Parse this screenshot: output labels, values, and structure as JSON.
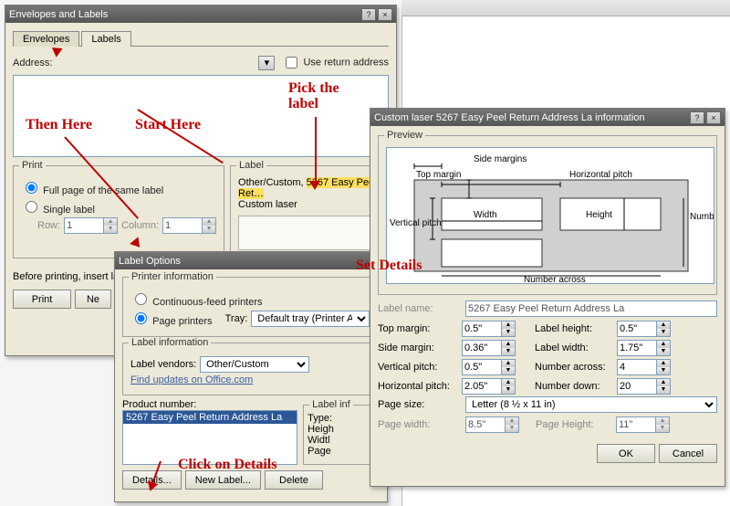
{
  "envelopesDialog": {
    "title": "Envelopes and Labels",
    "tabs": {
      "envelopes": "Envelopes",
      "labels": "Labels"
    },
    "addressLabel": "Address:",
    "useReturn": "Use return address",
    "printGroup": {
      "legend": "Print",
      "fullPage": "Full page of the same label",
      "single": "Single label",
      "rowLabel": "Row:",
      "rowValue": "1",
      "colLabel": "Column:",
      "colValue": "1"
    },
    "labelGroup": {
      "legend": "Label",
      "line1a": "Other/Custom, ",
      "line1b": "5267 Easy Peel Ret…",
      "line2": "Custom laser"
    },
    "beforePrinting": "Before printing, insert lab",
    "printBtn": "Print",
    "newBtn": "Ne"
  },
  "labelOptionsDialog": {
    "title": "Label Options",
    "printerInfoLegend": "Printer information",
    "continuous": "Continuous-feed printers",
    "page": "Page printers",
    "trayLabel": "Tray:",
    "trayValue": "Default tray (Printer Auto S",
    "labelInfoLegend": "Label information",
    "vendorsLabel": "Label vendors:",
    "vendorsValue": "Other/Custom",
    "officeLink": "Find updates on Office.com",
    "productLabel": "Product number:",
    "productSelected": "5267 Easy Peel Return Address La",
    "labelInfPanel": "Label inf",
    "typeLabel": "Type:",
    "heightLabel": "Heigh",
    "widthLabel": "Widtl",
    "pageLabel": "Page",
    "detailsBtn": "Details...",
    "newLabelBtn": "New Label...",
    "deleteBtn": "Delete"
  },
  "infoDialog": {
    "title": "Custom laser 5267 Easy Peel Return Address La information",
    "previewLegend": "Preview",
    "preview": {
      "sideMargins": "Side margins",
      "topMargin": "Top margin",
      "horizPitch": "Horizontal pitch",
      "vertPitch": "Vertical pitch",
      "width": "Width",
      "height": "Height",
      "numberDown": "Number down",
      "numberAcross": "Number across"
    },
    "labelNameLabel": "Label name:",
    "labelNameValue": "5267 Easy Peel Return Address La",
    "topMarginLabel": "Top margin:",
    "topMarginValue": "0.5\"",
    "sideMarginLabel": "Side margin:",
    "sideMarginValue": "0.36\"",
    "vertPitchLabel": "Vertical pitch:",
    "vertPitchValue": "0.5\"",
    "horizPitchLabel": "Horizontal pitch:",
    "horizPitchValue": "2.05\"",
    "labelHeightLabel": "Label height:",
    "labelHeightValue": "0.5\"",
    "labelWidthLabel": "Label width:",
    "labelWidthValue": "1.75\"",
    "numAcrossLabel": "Number across:",
    "numAcrossValue": "4",
    "numDownLabel": "Number down:",
    "numDownValue": "20",
    "pageSizeLabel": "Page size:",
    "pageSizeValue": "Letter (8 ½ x 11 in)",
    "pageWidthLabel": "Page width:",
    "pageWidthValue": "8.5\"",
    "pageHeightLabel": "Page Height:",
    "pageHeightValue": "11\"",
    "okBtn": "OK",
    "cancelBtn": "Cancel"
  },
  "annotations": {
    "startHere": "Start Here",
    "thenHere": "Then Here",
    "pickLabel": "Pick the label",
    "setDetails": "Set Details",
    "clickDetails": "Click on Details"
  }
}
